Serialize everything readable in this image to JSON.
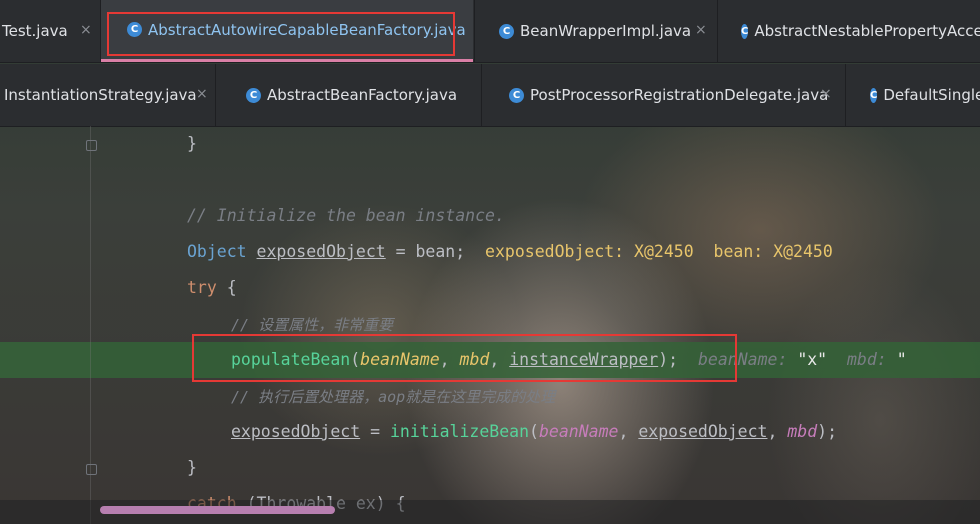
{
  "tabs_row1": [
    {
      "label": "Test.java",
      "icon": "java-class-icon",
      "active": false
    },
    {
      "label": "AbstractAutowireCapableBeanFactory.java",
      "icon": "java-class-icon",
      "active": true
    },
    {
      "label": "BeanWrapperImpl.java",
      "icon": "java-class-icon",
      "active": false
    },
    {
      "label": "AbstractNestablePropertyAccesso",
      "icon": "java-class-icon",
      "active": false
    }
  ],
  "tabs_row2": [
    {
      "label": "InstantiationStrategy.java",
      "icon": "java-interface-icon",
      "active": false
    },
    {
      "label": "AbstractBeanFactory.java",
      "icon": "java-class-icon",
      "active": false
    },
    {
      "label": "PostProcessorRegistrationDelegate.java",
      "icon": "java-class-icon",
      "active": false
    },
    {
      "label": "DefaultSingle",
      "icon": "java-class-icon",
      "active": false
    }
  ],
  "class_icon_letter": "C",
  "close_glyph": "×",
  "code": {
    "l1": "}",
    "l2": "// Initialize the bean instance.",
    "l3": {
      "type": "Object",
      "var": "exposedObject",
      "eq": " = bean;",
      "hint1": "exposedObject: X@2450",
      "hint2": "bean: X@2450"
    },
    "l4": {
      "kw": "try",
      "rest": " {"
    },
    "l5": "// 设置属性，非常重要",
    "l6": {
      "fn": "populateBean",
      "open": "(",
      "p1": "beanName",
      "c1": ", ",
      "p2": "mbd",
      "c2": ", ",
      "p3": "instanceWrapper",
      "close": ");",
      "hint_k1": "beanName:",
      "hint_v1": "\"x\"",
      "hint_k2": "mbd:",
      "hint_v2": "\""
    },
    "l7": "// 执行后置处理器，aop就是在这里完成的处理",
    "l8": {
      "var": "exposedObject",
      "eq": " = ",
      "fn": "initializeBean",
      "open": "(",
      "p1": "beanName",
      "c1": ", ",
      "p2": "exposedObject",
      "c2": ", ",
      "p3": "mbd",
      "close": ");"
    },
    "l9": "}",
    "l10": {
      "kw": "catch",
      "rest": " (Throwable ex) {"
    }
  },
  "colors": {
    "highlight_box": "#e53935",
    "active_tab_underline": "#d97fa6",
    "execution_line": "#346337"
  }
}
